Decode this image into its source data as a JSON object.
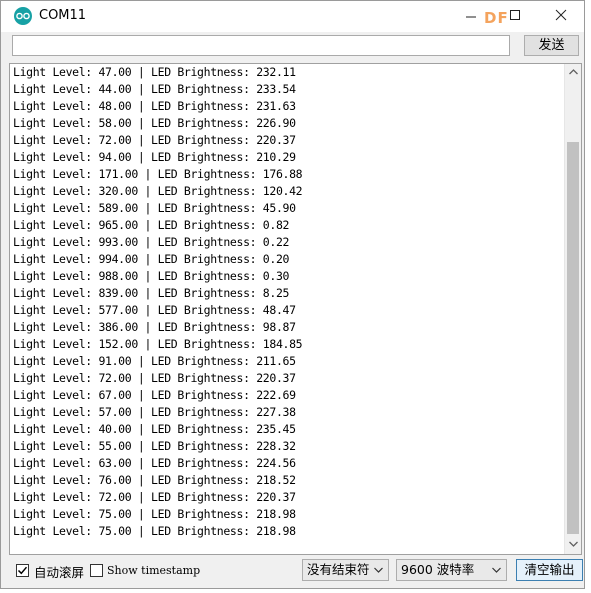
{
  "window": {
    "title": "COM11",
    "watermark": "DF"
  },
  "send_bar": {
    "input_value": "",
    "send_label": "发送"
  },
  "output": {
    "lines": [
      "Light Level: 47.00 | LED Brightness: 232.11",
      "Light Level: 44.00 | LED Brightness: 233.54",
      "Light Level: 48.00 | LED Brightness: 231.63",
      "Light Level: 58.00 | LED Brightness: 226.90",
      "Light Level: 72.00 | LED Brightness: 220.37",
      "Light Level: 94.00 | LED Brightness: 210.29",
      "Light Level: 171.00 | LED Brightness: 176.88",
      "Light Level: 320.00 | LED Brightness: 120.42",
      "Light Level: 589.00 | LED Brightness: 45.90",
      "Light Level: 965.00 | LED Brightness: 0.82",
      "Light Level: 993.00 | LED Brightness: 0.22",
      "Light Level: 994.00 | LED Brightness: 0.20",
      "Light Level: 988.00 | LED Brightness: 0.30",
      "Light Level: 839.00 | LED Brightness: 8.25",
      "Light Level: 577.00 | LED Brightness: 48.47",
      "Light Level: 386.00 | LED Brightness: 98.87",
      "Light Level: 152.00 | LED Brightness: 184.85",
      "Light Level: 91.00 | LED Brightness: 211.65",
      "Light Level: 72.00 | LED Brightness: 220.37",
      "Light Level: 67.00 | LED Brightness: 222.69",
      "Light Level: 57.00 | LED Brightness: 227.38",
      "Light Level: 40.00 | LED Brightness: 235.45",
      "Light Level: 55.00 | LED Brightness: 228.32",
      "Light Level: 63.00 | LED Brightness: 224.56",
      "Light Level: 76.00 | LED Brightness: 218.52",
      "Light Level: 72.00 | LED Brightness: 220.37",
      "Light Level: 75.00 | LED Brightness: 218.98",
      "Light Level: 75.00 | LED Brightness: 218.98"
    ]
  },
  "bottom_bar": {
    "autoscroll_label": "自动滚屏",
    "autoscroll_checked": true,
    "timestamp_label": "Show timestamp",
    "timestamp_checked": false,
    "line_ending": "没有结束符",
    "baud_rate": "9600 波特率",
    "clear_label": "清空输出"
  },
  "colors": {
    "app_icon": "#17a1a5",
    "watermark": "#f4a35d",
    "scroll_thumb": "#c1c1c1"
  }
}
